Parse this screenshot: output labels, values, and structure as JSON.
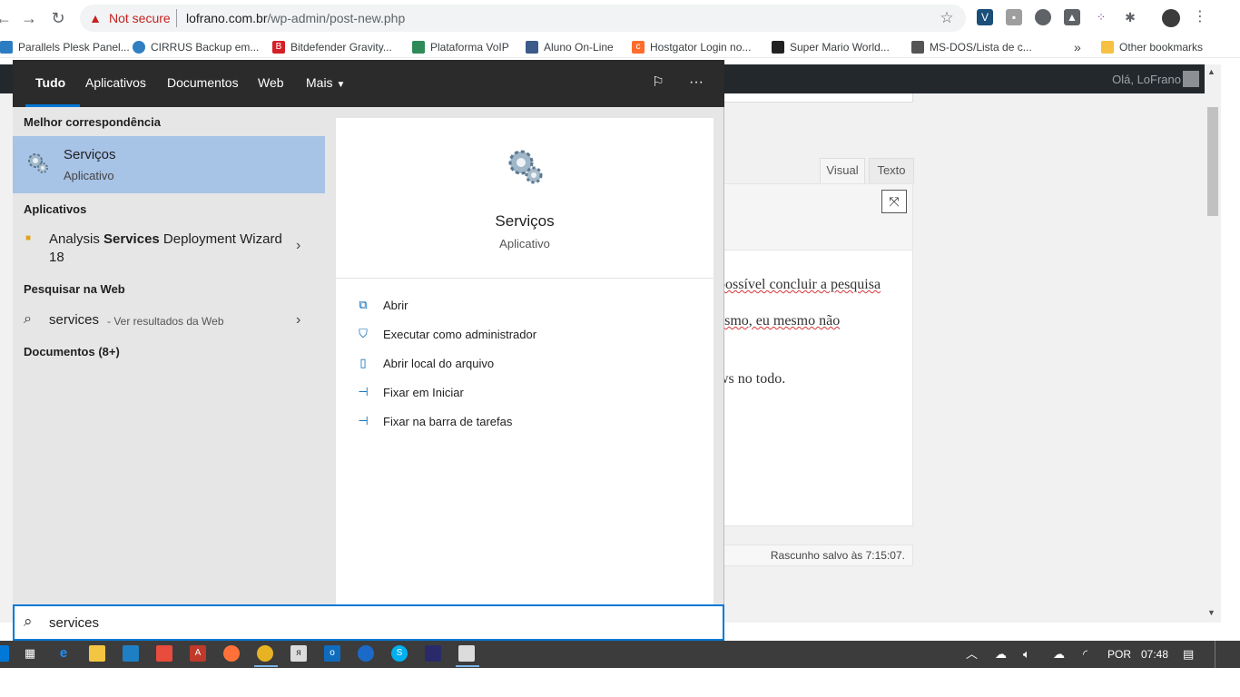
{
  "browser": {
    "security_label": "Not secure",
    "url_host": "lofrano.com.br",
    "url_path": "/wp-admin/post-new.php",
    "bookmarks": [
      {
        "label": "Parallels Plesk Panel...",
        "icon": "plesk-icon",
        "color": "#2c7cc2"
      },
      {
        "label": "CIRRUS Backup em...",
        "icon": "cloud-icon",
        "color": "#2f7fc1"
      },
      {
        "label": "Bitdefender Gravity...",
        "icon": "bitdefender-icon",
        "color": "#d51f26"
      },
      {
        "label": "Plataforma VoIP",
        "icon": "voip-icon",
        "color": "#2e8b57"
      },
      {
        "label": "Aluno On-Line",
        "icon": "student-icon",
        "color": "#3c5a8a"
      },
      {
        "label": "Hostgator Login no...",
        "icon": "cpanel-icon",
        "color": "#ff6c2c"
      },
      {
        "label": "Super Mario World...",
        "icon": "invader-icon",
        "color": "#222222"
      },
      {
        "label": "MS-DOS/Lista de c...",
        "icon": "wiki-icon",
        "color": "#555555"
      }
    ],
    "bookmarks_overflow": "»",
    "other_bookmarks": "Other bookmarks"
  },
  "wordpress": {
    "greeting": "Olá, LoFrano",
    "tab_visual": "Visual",
    "tab_text": "Texto",
    "content_lines": [
      "possível concluir a pesquisa",
      "esmo, eu mesmo não",
      "ws no todo."
    ],
    "draft_status": "Rascunho salvo às 7:15:07."
  },
  "search": {
    "tabs": [
      "Tudo",
      "Aplicativos",
      "Documentos",
      "Web",
      "Mais"
    ],
    "best_match_header": "Melhor correspondência",
    "best_match_title": "Serviços",
    "best_match_sub": "Aplicativo",
    "apps_header": "Aplicativos",
    "app_name_pre": "Analysis ",
    "app_name_bold": "Services",
    "app_name_post": " Deployment Wizard 18",
    "web_header": "Pesquisar na Web",
    "web_query": "services",
    "web_sub": "- Ver resultados da Web",
    "docs_header": "Documentos (8+)",
    "detail_title": "Serviços",
    "detail_sub": "Aplicativo",
    "actions": [
      {
        "label": "Abrir",
        "icon": "open-icon"
      },
      {
        "label": "Executar como administrador",
        "icon": "admin-shield-icon"
      },
      {
        "label": "Abrir local do arquivo",
        "icon": "file-location-icon"
      },
      {
        "label": "Fixar em Iniciar",
        "icon": "pin-icon"
      },
      {
        "label": "Fixar na barra de tarefas",
        "icon": "pin-taskbar-icon"
      }
    ],
    "query": "services"
  },
  "taskbar": {
    "language": "POR",
    "time": "07:48"
  },
  "colors": {
    "accent": "#0078d7",
    "selection": "#a7c3e6",
    "search_header": "#2b2b2b",
    "not_secure": "#c5221f"
  }
}
